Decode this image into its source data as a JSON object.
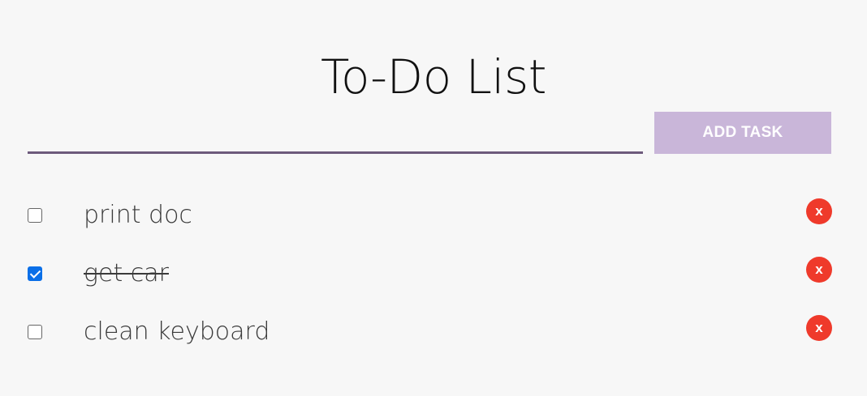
{
  "header": {
    "title": "To-Do List"
  },
  "new_task": {
    "value": "",
    "placeholder": "",
    "add_button_label": "ADD TASK"
  },
  "tasks": [
    {
      "label": "print doc",
      "completed": false,
      "delete_label": "x"
    },
    {
      "label": "get car",
      "completed": true,
      "delete_label": "x"
    },
    {
      "label": "clean keyboard",
      "completed": false,
      "delete_label": "x"
    }
  ],
  "colors": {
    "background": "#f7f7f7",
    "input_underline": "#6d5a7c",
    "add_button": "#c9b6d9",
    "delete_button": "#ef3a2b",
    "checkbox_checked": "#0a6fe8"
  },
  "icons": {
    "checkbox": "checkbox-icon",
    "delete": "delete-icon"
  }
}
